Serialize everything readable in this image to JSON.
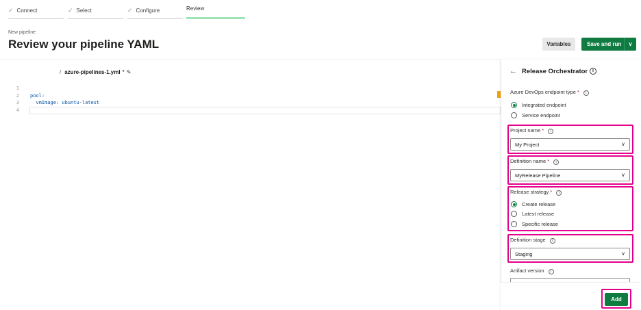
{
  "steps": [
    {
      "label": "Connect",
      "done": true
    },
    {
      "label": "Select",
      "done": true
    },
    {
      "label": "Configure",
      "done": true
    },
    {
      "label": "Review",
      "done": false,
      "active": true
    }
  ],
  "header": {
    "subtitle": "New pipeline",
    "title": "Review your pipeline YAML",
    "variables_label": "Variables",
    "save_run_label": "Save and run"
  },
  "editor": {
    "path_prefix": "/",
    "file_name": "azure-pipelines-1.yml",
    "modified_marker": "*",
    "lines": [
      {
        "number": "1",
        "text": ""
      },
      {
        "number": "2",
        "text": "pool:"
      },
      {
        "number": "3",
        "text": "  vmImage: ubuntu-latest"
      },
      {
        "number": "4",
        "text": ""
      }
    ]
  },
  "panel": {
    "title": "Release Orchestrator",
    "endpoint_type": {
      "label": "Azure DevOps endpoint type",
      "required": "*",
      "options": [
        "Integrated endpoint",
        "Service endpoint"
      ],
      "selected": "Integrated endpoint"
    },
    "project_name": {
      "label": "Project name",
      "required": "*",
      "value": "My Project"
    },
    "definition_name": {
      "label": "Definition name",
      "required": "*",
      "value": "MyRelease Pipeline"
    },
    "release_strategy": {
      "label": "Release strategy",
      "required": "*",
      "options": [
        "Create release",
        "Latest release",
        "Specific release"
      ],
      "selected": "Create release"
    },
    "definition_stage": {
      "label": "Definition stage",
      "value": "Staging"
    },
    "artifact_version": {
      "label": "Artifact version",
      "value": ""
    },
    "add_label": "Add"
  },
  "colors": {
    "accent_green": "#107c41",
    "highlight": "#e3008c",
    "active_step_underline": "#9de3b5"
  }
}
